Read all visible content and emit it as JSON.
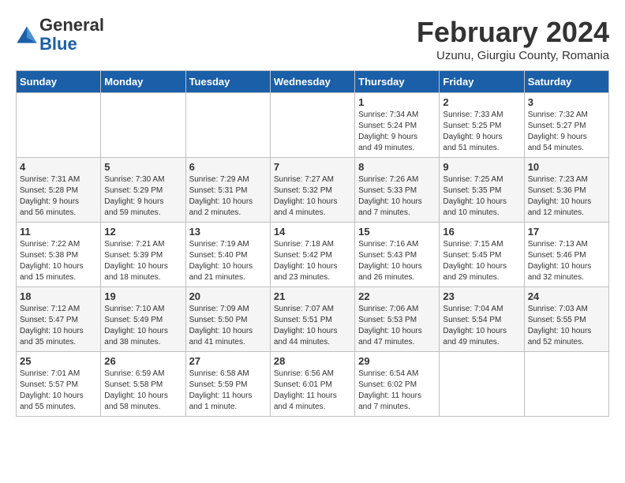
{
  "header": {
    "logo_general": "General",
    "logo_blue": "Blue",
    "month_year": "February 2024",
    "location": "Uzunu, Giurgiu County, Romania"
  },
  "days_of_week": [
    "Sunday",
    "Monday",
    "Tuesday",
    "Wednesday",
    "Thursday",
    "Friday",
    "Saturday"
  ],
  "weeks": [
    [
      {
        "day": "",
        "info": ""
      },
      {
        "day": "",
        "info": ""
      },
      {
        "day": "",
        "info": ""
      },
      {
        "day": "",
        "info": ""
      },
      {
        "day": "1",
        "info": "Sunrise: 7:34 AM\nSunset: 5:24 PM\nDaylight: 9 hours\nand 49 minutes."
      },
      {
        "day": "2",
        "info": "Sunrise: 7:33 AM\nSunset: 5:25 PM\nDaylight: 9 hours\nand 51 minutes."
      },
      {
        "day": "3",
        "info": "Sunrise: 7:32 AM\nSunset: 5:27 PM\nDaylight: 9 hours\nand 54 minutes."
      }
    ],
    [
      {
        "day": "4",
        "info": "Sunrise: 7:31 AM\nSunset: 5:28 PM\nDaylight: 9 hours\nand 56 minutes."
      },
      {
        "day": "5",
        "info": "Sunrise: 7:30 AM\nSunset: 5:29 PM\nDaylight: 9 hours\nand 59 minutes."
      },
      {
        "day": "6",
        "info": "Sunrise: 7:29 AM\nSunset: 5:31 PM\nDaylight: 10 hours\nand 2 minutes."
      },
      {
        "day": "7",
        "info": "Sunrise: 7:27 AM\nSunset: 5:32 PM\nDaylight: 10 hours\nand 4 minutes."
      },
      {
        "day": "8",
        "info": "Sunrise: 7:26 AM\nSunset: 5:33 PM\nDaylight: 10 hours\nand 7 minutes."
      },
      {
        "day": "9",
        "info": "Sunrise: 7:25 AM\nSunset: 5:35 PM\nDaylight: 10 hours\nand 10 minutes."
      },
      {
        "day": "10",
        "info": "Sunrise: 7:23 AM\nSunset: 5:36 PM\nDaylight: 10 hours\nand 12 minutes."
      }
    ],
    [
      {
        "day": "11",
        "info": "Sunrise: 7:22 AM\nSunset: 5:38 PM\nDaylight: 10 hours\nand 15 minutes."
      },
      {
        "day": "12",
        "info": "Sunrise: 7:21 AM\nSunset: 5:39 PM\nDaylight: 10 hours\nand 18 minutes."
      },
      {
        "day": "13",
        "info": "Sunrise: 7:19 AM\nSunset: 5:40 PM\nDaylight: 10 hours\nand 21 minutes."
      },
      {
        "day": "14",
        "info": "Sunrise: 7:18 AM\nSunset: 5:42 PM\nDaylight: 10 hours\nand 23 minutes."
      },
      {
        "day": "15",
        "info": "Sunrise: 7:16 AM\nSunset: 5:43 PM\nDaylight: 10 hours\nand 26 minutes."
      },
      {
        "day": "16",
        "info": "Sunrise: 7:15 AM\nSunset: 5:45 PM\nDaylight: 10 hours\nand 29 minutes."
      },
      {
        "day": "17",
        "info": "Sunrise: 7:13 AM\nSunset: 5:46 PM\nDaylight: 10 hours\nand 32 minutes."
      }
    ],
    [
      {
        "day": "18",
        "info": "Sunrise: 7:12 AM\nSunset: 5:47 PM\nDaylight: 10 hours\nand 35 minutes."
      },
      {
        "day": "19",
        "info": "Sunrise: 7:10 AM\nSunset: 5:49 PM\nDaylight: 10 hours\nand 38 minutes."
      },
      {
        "day": "20",
        "info": "Sunrise: 7:09 AM\nSunset: 5:50 PM\nDaylight: 10 hours\nand 41 minutes."
      },
      {
        "day": "21",
        "info": "Sunrise: 7:07 AM\nSunset: 5:51 PM\nDaylight: 10 hours\nand 44 minutes."
      },
      {
        "day": "22",
        "info": "Sunrise: 7:06 AM\nSunset: 5:53 PM\nDaylight: 10 hours\nand 47 minutes."
      },
      {
        "day": "23",
        "info": "Sunrise: 7:04 AM\nSunset: 5:54 PM\nDaylight: 10 hours\nand 49 minutes."
      },
      {
        "day": "24",
        "info": "Sunrise: 7:03 AM\nSunset: 5:55 PM\nDaylight: 10 hours\nand 52 minutes."
      }
    ],
    [
      {
        "day": "25",
        "info": "Sunrise: 7:01 AM\nSunset: 5:57 PM\nDaylight: 10 hours\nand 55 minutes."
      },
      {
        "day": "26",
        "info": "Sunrise: 6:59 AM\nSunset: 5:58 PM\nDaylight: 10 hours\nand 58 minutes."
      },
      {
        "day": "27",
        "info": "Sunrise: 6:58 AM\nSunset: 5:59 PM\nDaylight: 11 hours\nand 1 minute."
      },
      {
        "day": "28",
        "info": "Sunrise: 6:56 AM\nSunset: 6:01 PM\nDaylight: 11 hours\nand 4 minutes."
      },
      {
        "day": "29",
        "info": "Sunrise: 6:54 AM\nSunset: 6:02 PM\nDaylight: 11 hours\nand 7 minutes."
      },
      {
        "day": "",
        "info": ""
      },
      {
        "day": "",
        "info": ""
      }
    ]
  ]
}
